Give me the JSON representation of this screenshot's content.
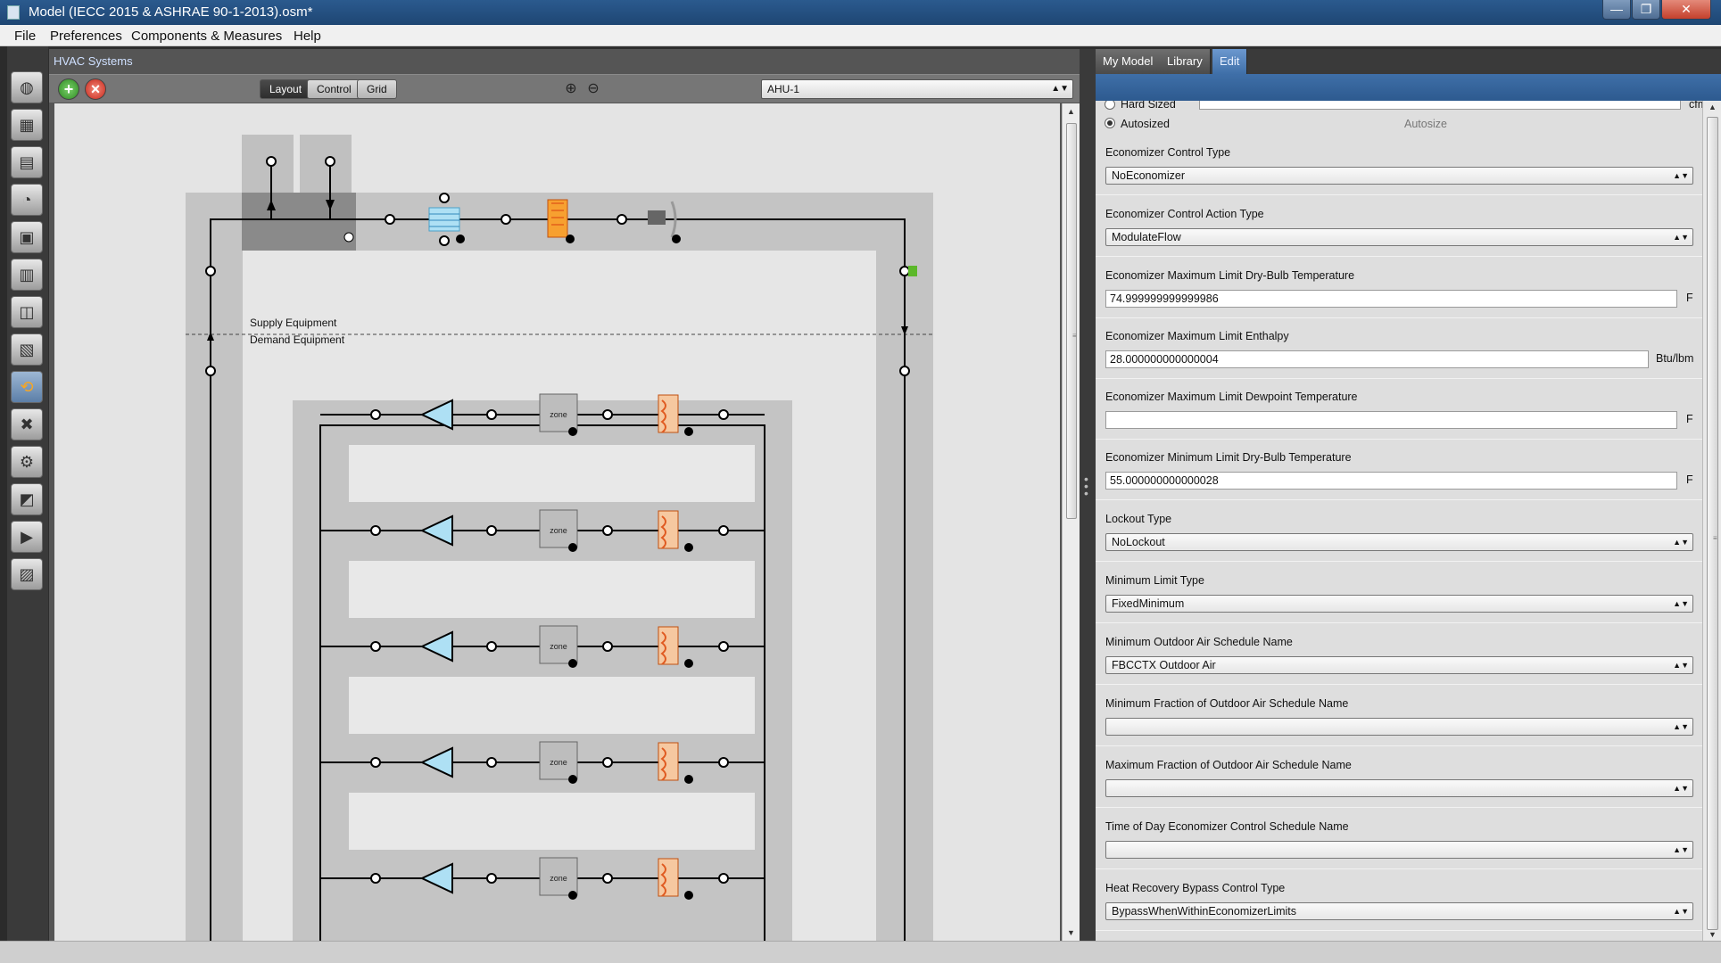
{
  "window": {
    "title": "Model (IECC 2015 & ASHRAE 90-1-2013).osm*",
    "min": "—",
    "max": "❐",
    "close": "✕"
  },
  "menu": {
    "file": "File",
    "preferences": "Preferences",
    "components": "Components & Measures",
    "help": "Help"
  },
  "nav_icons": [
    "site-icon",
    "schedules-icon",
    "constructions-icon",
    "loads-icon",
    "space-types-icon",
    "facility-icon",
    "spaces-icon",
    "thermal-zones-icon",
    "hvac-systems-icon",
    "building-summary-icon",
    "measures-icon",
    "simulation-settings-icon",
    "run-simulation-icon",
    "results-icon"
  ],
  "hvac": {
    "panel_title": "HVAC Systems",
    "layout_label": "Layout",
    "control_label": "Control",
    "grid_label": "Grid",
    "airloop_selected": "AHU-1",
    "supply_label": "Supply Equipment",
    "demand_label": "Demand Equipment",
    "zone_label": "zone"
  },
  "tabs": {
    "my_model": "My Model",
    "library": "Library",
    "edit": "Edit"
  },
  "inspector": {
    "hard_sized_label": "Hard Sized",
    "hard_sized_unit": "cfm",
    "autosized_label": "Autosized",
    "autosize_text": "Autosize",
    "fields": {
      "econ_control_type": {
        "label": "Economizer Control Type",
        "value": "NoEconomizer"
      },
      "econ_action_type": {
        "label": "Economizer Control Action Type",
        "value": "ModulateFlow"
      },
      "econ_max_drybulb": {
        "label": "Economizer Maximum Limit Dry-Bulb Temperature",
        "value": "74.999999999999986",
        "unit": "F"
      },
      "econ_max_enthalpy": {
        "label": "Economizer Maximum Limit Enthalpy",
        "value": "28.000000000000004",
        "unit": "Btu/lbm"
      },
      "econ_max_dewpoint": {
        "label": "Economizer Maximum Limit Dewpoint Temperature",
        "value": "",
        "unit": "F"
      },
      "econ_min_drybulb": {
        "label": "Economizer Minimum Limit Dry-Bulb Temperature",
        "value": "55.000000000000028",
        "unit": "F"
      },
      "lockout_type": {
        "label": "Lockout Type",
        "value": "NoLockout"
      },
      "min_limit_type": {
        "label": "Minimum Limit Type",
        "value": "FixedMinimum"
      },
      "min_oa_schedule": {
        "label": "Minimum Outdoor Air Schedule Name",
        "value": "FBCCTX Outdoor Air"
      },
      "min_frac_oa_schedule": {
        "label": "Minimum Fraction of Outdoor Air Schedule Name",
        "value": ""
      },
      "max_frac_oa_schedule": {
        "label": "Maximum Fraction of Outdoor Air Schedule Name",
        "value": ""
      },
      "tod_econ_schedule": {
        "label": "Time of Day Economizer Control Schedule Name",
        "value": ""
      },
      "hr_bypass_type": {
        "label": "Heat Recovery Bypass Control Type",
        "value": "BypassWhenWithinEconomizerLimits"
      }
    }
  }
}
